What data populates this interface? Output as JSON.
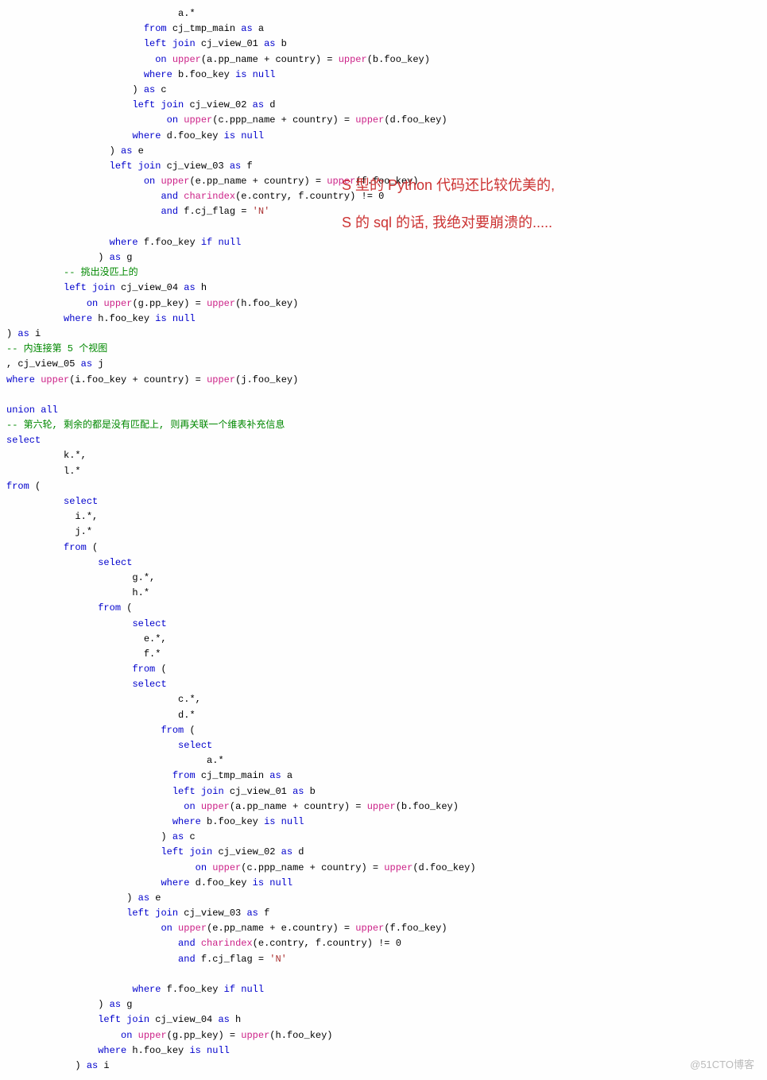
{
  "annotation": {
    "line1": "S 型的 Python 代码还比较优美的,",
    "line2": "S 的 sql 的话, 我绝对要崩溃的....."
  },
  "watermark": "@51CTO博客",
  "code": [
    {
      "indent": 30,
      "tokens": [
        [
          "",
          "a.*"
        ]
      ]
    },
    {
      "indent": 24,
      "tokens": [
        [
          "kw",
          "from"
        ],
        [
          "",
          " cj_tmp_main "
        ],
        [
          "kw",
          "as"
        ],
        [
          "",
          " a"
        ]
      ]
    },
    {
      "indent": 24,
      "tokens": [
        [
          "kw",
          "left join"
        ],
        [
          "",
          " cj_view_01 "
        ],
        [
          "kw",
          "as"
        ],
        [
          "",
          " b"
        ]
      ]
    },
    {
      "indent": 26,
      "tokens": [
        [
          "kw",
          "on"
        ],
        [
          "",
          " "
        ],
        [
          "func",
          "upper"
        ],
        [
          "",
          "(a.pp_name + country) = "
        ],
        [
          "func",
          "upper"
        ],
        [
          "",
          "(b.foo_key)"
        ]
      ]
    },
    {
      "indent": 24,
      "tokens": [
        [
          "kw",
          "where"
        ],
        [
          "",
          " b.foo_key "
        ],
        [
          "kw",
          "is null"
        ]
      ]
    },
    {
      "indent": 20,
      "tokens": [
        [
          "",
          "  ) "
        ],
        [
          "kw",
          "as"
        ],
        [
          "",
          " c"
        ]
      ]
    },
    {
      "indent": 22,
      "tokens": [
        [
          "kw",
          "left join"
        ],
        [
          "",
          " cj_view_02 "
        ],
        [
          "kw",
          "as"
        ],
        [
          "",
          " d"
        ]
      ]
    },
    {
      "indent": 28,
      "tokens": [
        [
          "kw",
          "on"
        ],
        [
          "",
          " "
        ],
        [
          "func",
          "upper"
        ],
        [
          "",
          "(c.ppp_name + country) = "
        ],
        [
          "func",
          "upper"
        ],
        [
          "",
          "(d.foo_key)"
        ]
      ]
    },
    {
      "indent": 22,
      "tokens": [
        [
          "kw",
          "where"
        ],
        [
          "",
          " d.foo_key "
        ],
        [
          "kw",
          "is null"
        ]
      ]
    },
    {
      "indent": 16,
      "tokens": [
        [
          "",
          "  ) "
        ],
        [
          "kw",
          "as"
        ],
        [
          "",
          " e"
        ]
      ]
    },
    {
      "indent": 18,
      "tokens": [
        [
          "kw",
          "left join"
        ],
        [
          "",
          " cj_view_03 "
        ],
        [
          "kw",
          "as"
        ],
        [
          "",
          " f"
        ]
      ]
    },
    {
      "indent": 24,
      "tokens": [
        [
          "kw",
          "on"
        ],
        [
          "",
          " "
        ],
        [
          "func",
          "upper"
        ],
        [
          "",
          "(e.pp_name + country) = "
        ],
        [
          "func",
          "upper"
        ],
        [
          "",
          "(f.foo_key)"
        ]
      ]
    },
    {
      "indent": 27,
      "tokens": [
        [
          "kw",
          "and"
        ],
        [
          "",
          " "
        ],
        [
          "func",
          "charindex"
        ],
        [
          "",
          "(e.contry, f.country) != 0"
        ]
      ]
    },
    {
      "indent": 27,
      "tokens": [
        [
          "kw",
          "and"
        ],
        [
          "",
          " f.cj_flag = "
        ],
        [
          "str",
          "'N'"
        ]
      ]
    },
    {
      "indent": 0,
      "tokens": [
        [
          "",
          ""
        ]
      ]
    },
    {
      "indent": 18,
      "tokens": [
        [
          "kw",
          "where"
        ],
        [
          "",
          " f.foo_key "
        ],
        [
          "kw",
          "if null"
        ]
      ]
    },
    {
      "indent": 14,
      "tokens": [
        [
          "",
          "  ) "
        ],
        [
          "kw",
          "as"
        ],
        [
          "",
          " g"
        ]
      ]
    },
    {
      "indent": 10,
      "tokens": [
        [
          "comment",
          "-- 挑出没匹上的"
        ]
      ]
    },
    {
      "indent": 10,
      "tokens": [
        [
          "kw",
          "left join"
        ],
        [
          "",
          " cj_view_04 "
        ],
        [
          "kw",
          "as"
        ],
        [
          "",
          " h"
        ]
      ]
    },
    {
      "indent": 14,
      "tokens": [
        [
          "kw",
          "on"
        ],
        [
          "",
          " "
        ],
        [
          "func",
          "upper"
        ],
        [
          "",
          "(g.pp_key) = "
        ],
        [
          "func",
          "upper"
        ],
        [
          "",
          "(h.foo_key)"
        ]
      ]
    },
    {
      "indent": 10,
      "tokens": [
        [
          "kw",
          "where"
        ],
        [
          "",
          " h.foo_key "
        ],
        [
          "kw",
          "is null"
        ]
      ]
    },
    {
      "indent": 0,
      "tokens": [
        [
          "",
          ") "
        ],
        [
          "kw",
          "as"
        ],
        [
          "",
          " i"
        ]
      ]
    },
    {
      "indent": 0,
      "tokens": [
        [
          "comment",
          "-- 内连接第 5 个视图"
        ]
      ]
    },
    {
      "indent": 0,
      "tokens": [
        [
          "",
          ", cj_view_05 "
        ],
        [
          "kw",
          "as"
        ],
        [
          "",
          " j"
        ]
      ]
    },
    {
      "indent": 0,
      "tokens": [
        [
          "kw",
          "where"
        ],
        [
          "",
          " "
        ],
        [
          "func",
          "upper"
        ],
        [
          "",
          "(i.foo_key + country) = "
        ],
        [
          "func",
          "upper"
        ],
        [
          "",
          "(j.foo_key)"
        ]
      ]
    },
    {
      "indent": 0,
      "tokens": [
        [
          "",
          ""
        ]
      ]
    },
    {
      "indent": 0,
      "tokens": [
        [
          "kw",
          "union"
        ],
        [
          "",
          " "
        ],
        [
          "kw",
          "all"
        ]
      ]
    },
    {
      "indent": 0,
      "tokens": [
        [
          "comment",
          "-- 第六轮, 剩余的都是没有匹配上, 则再关联一个维表补充信息"
        ]
      ]
    },
    {
      "indent": 0,
      "tokens": [
        [
          "kw",
          "select"
        ]
      ]
    },
    {
      "indent": 10,
      "tokens": [
        [
          "",
          "k.*,"
        ]
      ]
    },
    {
      "indent": 10,
      "tokens": [
        [
          "",
          "l.*"
        ]
      ]
    },
    {
      "indent": 0,
      "tokens": [
        [
          "kw",
          "from"
        ],
        [
          "",
          " ("
        ]
      ]
    },
    {
      "indent": 10,
      "tokens": [
        [
          "kw",
          "select"
        ]
      ]
    },
    {
      "indent": 12,
      "tokens": [
        [
          "",
          "i.*,"
        ]
      ]
    },
    {
      "indent": 12,
      "tokens": [
        [
          "",
          "j.*"
        ]
      ]
    },
    {
      "indent": 10,
      "tokens": [
        [
          "kw",
          "from"
        ],
        [
          "",
          " ("
        ]
      ]
    },
    {
      "indent": 16,
      "tokens": [
        [
          "kw",
          "select"
        ]
      ]
    },
    {
      "indent": 22,
      "tokens": [
        [
          "",
          "g.*,"
        ]
      ]
    },
    {
      "indent": 22,
      "tokens": [
        [
          "",
          "h.*"
        ]
      ]
    },
    {
      "indent": 16,
      "tokens": [
        [
          "kw",
          "from"
        ],
        [
          "",
          " ("
        ]
      ]
    },
    {
      "indent": 22,
      "tokens": [
        [
          "kw",
          "select"
        ]
      ]
    },
    {
      "indent": 24,
      "tokens": [
        [
          "",
          "e.*,"
        ]
      ]
    },
    {
      "indent": 24,
      "tokens": [
        [
          "",
          "f.*"
        ]
      ]
    },
    {
      "indent": 22,
      "tokens": [
        [
          "kw",
          "from"
        ],
        [
          "",
          " ("
        ]
      ]
    },
    {
      "indent": 22,
      "tokens": [
        [
          "kw",
          "select"
        ]
      ]
    },
    {
      "indent": 30,
      "tokens": [
        [
          "",
          "c.*,"
        ]
      ]
    },
    {
      "indent": 30,
      "tokens": [
        [
          "",
          "d.*"
        ]
      ]
    },
    {
      "indent": 27,
      "tokens": [
        [
          "kw",
          "from"
        ],
        [
          "",
          " ("
        ]
      ]
    },
    {
      "indent": 30,
      "tokens": [
        [
          "kw",
          "select"
        ]
      ]
    },
    {
      "indent": 35,
      "tokens": [
        [
          "",
          "a.*"
        ]
      ]
    },
    {
      "indent": 29,
      "tokens": [
        [
          "kw",
          "from"
        ],
        [
          "",
          " cj_tmp_main "
        ],
        [
          "kw",
          "as"
        ],
        [
          "",
          " a"
        ]
      ]
    },
    {
      "indent": 29,
      "tokens": [
        [
          "kw",
          "left join"
        ],
        [
          "",
          " cj_view_01 "
        ],
        [
          "kw",
          "as"
        ],
        [
          "",
          " b"
        ]
      ]
    },
    {
      "indent": 31,
      "tokens": [
        [
          "kw",
          "on"
        ],
        [
          "",
          " "
        ],
        [
          "func",
          "upper"
        ],
        [
          "",
          "(a.pp_name + country) = "
        ],
        [
          "func",
          "upper"
        ],
        [
          "",
          "(b.foo_key)"
        ]
      ]
    },
    {
      "indent": 29,
      "tokens": [
        [
          "kw",
          "where"
        ],
        [
          "",
          " b.foo_key "
        ],
        [
          "kw",
          "is null"
        ]
      ]
    },
    {
      "indent": 25,
      "tokens": [
        [
          "",
          "  ) "
        ],
        [
          "kw",
          "as"
        ],
        [
          "",
          " c"
        ]
      ]
    },
    {
      "indent": 27,
      "tokens": [
        [
          "kw",
          "left join"
        ],
        [
          "",
          " cj_view_02 "
        ],
        [
          "kw",
          "as"
        ],
        [
          "",
          " d"
        ]
      ]
    },
    {
      "indent": 33,
      "tokens": [
        [
          "kw",
          "on"
        ],
        [
          "",
          " "
        ],
        [
          "func",
          "upper"
        ],
        [
          "",
          "(c.ppp_name + country) = "
        ],
        [
          "func",
          "upper"
        ],
        [
          "",
          "(d.foo_key)"
        ]
      ]
    },
    {
      "indent": 27,
      "tokens": [
        [
          "kw",
          "where"
        ],
        [
          "",
          " d.foo_key "
        ],
        [
          "kw",
          "is null"
        ]
      ]
    },
    {
      "indent": 19,
      "tokens": [
        [
          "",
          "  ) "
        ],
        [
          "kw",
          "as"
        ],
        [
          "",
          " e"
        ]
      ]
    },
    {
      "indent": 21,
      "tokens": [
        [
          "kw",
          "left join"
        ],
        [
          "",
          " cj_view_03 "
        ],
        [
          "kw",
          "as"
        ],
        [
          "",
          " f"
        ]
      ]
    },
    {
      "indent": 27,
      "tokens": [
        [
          "kw",
          "on"
        ],
        [
          "",
          " "
        ],
        [
          "func",
          "upper"
        ],
        [
          "",
          "(e.pp_name + e.country) = "
        ],
        [
          "func",
          "upper"
        ],
        [
          "",
          "(f.foo_key)"
        ]
      ]
    },
    {
      "indent": 30,
      "tokens": [
        [
          "kw",
          "and"
        ],
        [
          "",
          " "
        ],
        [
          "func",
          "charindex"
        ],
        [
          "",
          "(e.contry, f.country) != 0"
        ]
      ]
    },
    {
      "indent": 30,
      "tokens": [
        [
          "kw",
          "and"
        ],
        [
          "",
          " f.cj_flag = "
        ],
        [
          "str",
          "'N'"
        ]
      ]
    },
    {
      "indent": 0,
      "tokens": [
        [
          "",
          ""
        ]
      ]
    },
    {
      "indent": 22,
      "tokens": [
        [
          "kw",
          "where"
        ],
        [
          "",
          " f.foo_key "
        ],
        [
          "kw",
          "if null"
        ]
      ]
    },
    {
      "indent": 14,
      "tokens": [
        [
          "",
          "  ) "
        ],
        [
          "kw",
          "as"
        ],
        [
          "",
          " g"
        ]
      ]
    },
    {
      "indent": 16,
      "tokens": [
        [
          "kw",
          "left join"
        ],
        [
          "",
          " cj_view_04 "
        ],
        [
          "kw",
          "as"
        ],
        [
          "",
          " h"
        ]
      ]
    },
    {
      "indent": 20,
      "tokens": [
        [
          "kw",
          "on"
        ],
        [
          "",
          " "
        ],
        [
          "func",
          "upper"
        ],
        [
          "",
          "(g.pp_key) = "
        ],
        [
          "func",
          "upper"
        ],
        [
          "",
          "(h.foo_key)"
        ]
      ]
    },
    {
      "indent": 16,
      "tokens": [
        [
          "kw",
          "where"
        ],
        [
          "",
          " h.foo_key "
        ],
        [
          "kw",
          "is null"
        ]
      ]
    },
    {
      "indent": 10,
      "tokens": [
        [
          "",
          "  ) "
        ],
        [
          "kw",
          "as"
        ],
        [
          "",
          " i"
        ]
      ]
    }
  ]
}
